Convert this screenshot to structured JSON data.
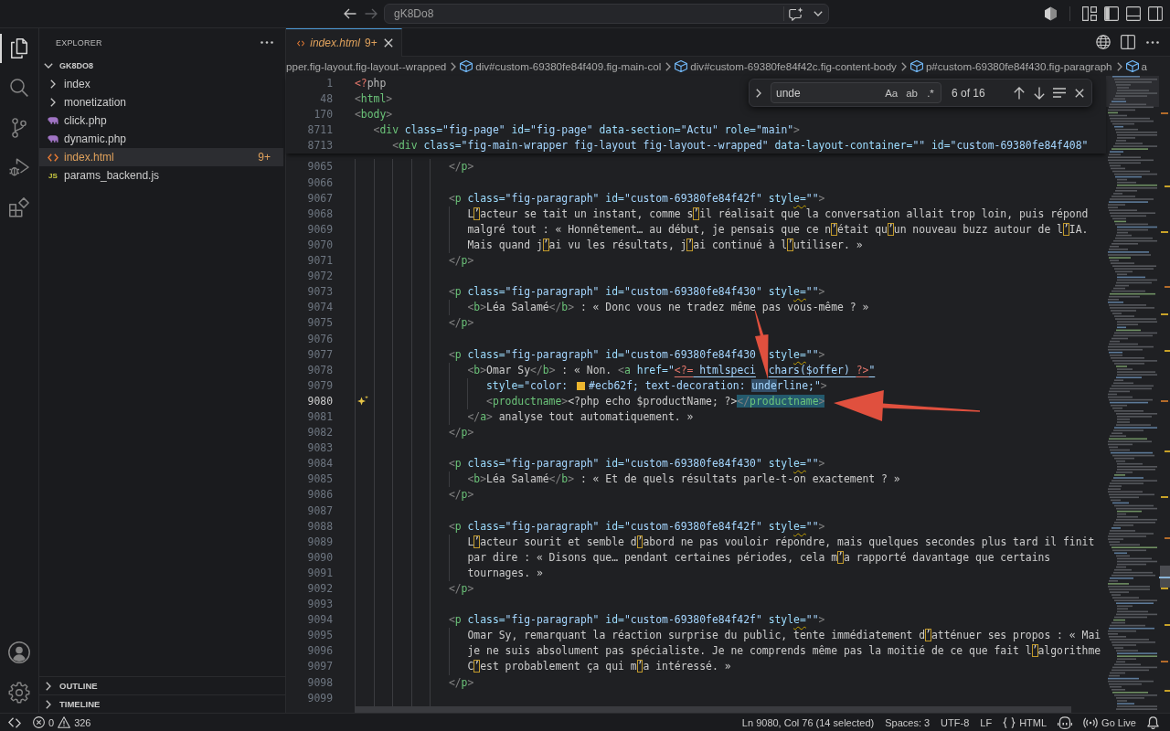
{
  "title_bar": {
    "back": {
      "disabled": false
    },
    "forward": {
      "disabled": true
    },
    "command_center": {
      "label": "gK8Do8"
    }
  },
  "activity_bar": {
    "items": [
      {
        "selected": true
      },
      {
        "selected": false
      },
      {
        "selected": false
      },
      {
        "selected": false
      },
      {
        "selected": false
      }
    ]
  },
  "sidebar": {
    "title": "EXPLORER",
    "root": {
      "name": "GK8DO8",
      "expanded": true,
      "children": [
        {
          "name": "index",
          "kind": "folder",
          "expanded": false,
          "selected": false
        },
        {
          "name": "monetization",
          "kind": "folder",
          "expanded": false,
          "selected": false
        },
        {
          "name": "click.php",
          "kind": "php",
          "selected": false
        },
        {
          "name": "dynamic.php",
          "kind": "php",
          "selected": false
        },
        {
          "name": "index.html",
          "kind": "html",
          "selected": true,
          "badge": "9+"
        },
        {
          "name": "params_backend.js",
          "kind": "js",
          "icon_label": "JS",
          "selected": false
        }
      ]
    },
    "sections": [
      {
        "title": "OUTLINE",
        "expanded": false
      },
      {
        "title": "TIMELINE",
        "expanded": false
      }
    ]
  },
  "editor": {
    "tabs": [
      {
        "label": "index.html",
        "badge": "9+",
        "preview": true,
        "selected": true
      }
    ],
    "breadcrumbs": [
      {
        "kind": "partial",
        "text": "pper.fig-layout.fig-layout--wrapped"
      },
      {
        "kind": "element",
        "text": "div#custom-69380fe84f409.fig-main-col"
      },
      {
        "kind": "element",
        "text": "div#custom-69380fe84f42c.fig-content-body"
      },
      {
        "kind": "element",
        "text": "p#custom-69380fe84f430.fig-paragraph"
      },
      {
        "kind": "element",
        "text": "a"
      }
    ],
    "find": {
      "query": "unde",
      "result": "6 of 16",
      "replace_expanded": false,
      "options": [
        {
          "label": "Aa",
          "on": false
        },
        {
          "label": "ab",
          "on": false
        },
        {
          "label": ".*",
          "on": false
        }
      ]
    },
    "sticky_lines": [
      {
        "number": "1",
        "tokens": [
          {
            "kind": "php",
            "text": "<?"
          },
          {
            "kind": "keyword",
            "text": "php"
          }
        ]
      },
      {
        "number": "48",
        "tokens": [
          {
            "kind": "punct",
            "text": "<"
          },
          {
            "kind": "tag",
            "text": "html"
          },
          {
            "kind": "punct",
            "text": ">"
          }
        ]
      },
      {
        "number": "170",
        "tokens": [
          {
            "kind": "punct",
            "text": "<"
          },
          {
            "kind": "tag",
            "text": "body"
          },
          {
            "kind": "punct",
            "text": ">"
          }
        ]
      },
      {
        "number": "8711",
        "tokens": [
          {
            "kind": "punct",
            "text": "   <"
          },
          {
            "kind": "tag",
            "text": "div"
          },
          {
            "kind": "attr",
            "text": " class="
          },
          {
            "kind": "str",
            "text": "\"fig-page\""
          },
          {
            "kind": "attr",
            "text": " id="
          },
          {
            "kind": "str",
            "text": "\"fig-page\""
          },
          {
            "kind": "attr",
            "text": " data-section="
          },
          {
            "kind": "str",
            "text": "\"Actu\""
          },
          {
            "kind": "attr",
            "text": " role="
          },
          {
            "kind": "str",
            "text": "\"main\""
          },
          {
            "kind": "punct",
            "text": ">"
          }
        ]
      },
      {
        "number": "8713",
        "tokens": [
          {
            "kind": "punct",
            "text": "      <"
          },
          {
            "kind": "tag",
            "text": "div"
          },
          {
            "kind": "attr",
            "text": " class="
          },
          {
            "kind": "str",
            "text": "\"fig-main-wrapper fig-layout fig-layout--wrapped\""
          },
          {
            "kind": "attr",
            "text": " data-layout-container="
          },
          {
            "kind": "str",
            "text": "\"\""
          },
          {
            "kind": "attr",
            "text": " id="
          },
          {
            "kind": "str",
            "text": "\"custom-69380fe84f408\""
          }
        ]
      }
    ],
    "lines": [
      {
        "number": "9065",
        "current": false,
        "tokens": [
          {
            "kind": "punct",
            "text": "               </"
          },
          {
            "kind": "tag",
            "text": "p"
          },
          {
            "kind": "punct",
            "text": ">"
          }
        ]
      },
      {
        "number": "9066",
        "current": false
      },
      {
        "number": "9067",
        "current": false,
        "tokens": [
          {
            "kind": "punct",
            "text": "               <"
          },
          {
            "kind": "tag",
            "text": "p"
          },
          {
            "kind": "attr",
            "text": " class="
          },
          {
            "kind": "str",
            "text": "\"fig-paragraph\""
          },
          {
            "kind": "attr",
            "text": " id="
          },
          {
            "kind": "str",
            "text": "\"custom-69380fe84f42f\""
          },
          {
            "kind": "attr",
            "text": " styl"
          },
          {
            "kind": "attr-warning",
            "text": "e="
          },
          {
            "kind": "str",
            "text": "\"\""
          },
          {
            "kind": "punct",
            "text": ">"
          }
        ]
      },
      {
        "number": "9068",
        "current": false,
        "tokens": [
          {
            "kind": "text",
            "text": "                  L"
          },
          {
            "kind": "ambiguous",
            "text": "’"
          },
          {
            "kind": "text",
            "text": "acteur se tait un instant, comme s"
          },
          {
            "kind": "ambiguous",
            "text": "’"
          },
          {
            "kind": "text",
            "text": "il réalisait que la conversation allait trop loin, puis répond"
          }
        ]
      },
      {
        "number": "9069",
        "current": false,
        "tokens": [
          {
            "kind": "text",
            "text": "                  malgré tout : « Honnêtement… au début, je pensais que ce n"
          },
          {
            "kind": "ambiguous",
            "text": "’"
          },
          {
            "kind": "text",
            "text": "était qu"
          },
          {
            "kind": "ambiguous",
            "text": "’"
          },
          {
            "kind": "text",
            "text": "un nouveau buzz autour de l"
          },
          {
            "kind": "ambiguous",
            "text": "’"
          },
          {
            "kind": "text",
            "text": "IA."
          }
        ]
      },
      {
        "number": "9070",
        "current": false,
        "tokens": [
          {
            "kind": "text",
            "text": "                  Mais quand j"
          },
          {
            "kind": "ambiguous",
            "text": "’"
          },
          {
            "kind": "text",
            "text": "ai vu les résultats, j"
          },
          {
            "kind": "ambiguous",
            "text": "’"
          },
          {
            "kind": "text",
            "text": "ai continué à l"
          },
          {
            "kind": "ambiguous",
            "text": "’"
          },
          {
            "kind": "text",
            "text": "utiliser. »"
          }
        ]
      },
      {
        "number": "9071",
        "current": false,
        "tokens": [
          {
            "kind": "punct",
            "text": "               </"
          },
          {
            "kind": "tag",
            "text": "p"
          },
          {
            "kind": "punct",
            "text": ">"
          }
        ]
      },
      {
        "number": "9072",
        "current": false
      },
      {
        "number": "9073",
        "current": false,
        "tokens": [
          {
            "kind": "punct",
            "text": "               <"
          },
          {
            "kind": "tag",
            "text": "p"
          },
          {
            "kind": "attr",
            "text": " class="
          },
          {
            "kind": "str",
            "text": "\"fig-paragraph\""
          },
          {
            "kind": "attr",
            "text": " id="
          },
          {
            "kind": "str",
            "text": "\"custom-69380fe84f430\""
          },
          {
            "kind": "attr",
            "text": " styl"
          },
          {
            "kind": "attr-warning",
            "text": "e="
          },
          {
            "kind": "str",
            "text": "\"\""
          },
          {
            "kind": "punct",
            "text": ">"
          }
        ]
      },
      {
        "number": "9074",
        "current": false,
        "tokens": [
          {
            "kind": "punct",
            "text": "                  <"
          },
          {
            "kind": "tag",
            "text": "b"
          },
          {
            "kind": "punct",
            "text": ">"
          },
          {
            "kind": "text",
            "text": "Léa Salamé"
          },
          {
            "kind": "punct",
            "text": "</"
          },
          {
            "kind": "tag",
            "text": "b"
          },
          {
            "kind": "punct",
            "text": ">"
          },
          {
            "kind": "text",
            "text": " : « Donc vous ne tradez même pas vous-même ? »"
          }
        ]
      },
      {
        "number": "9075",
        "current": false,
        "tokens": [
          {
            "kind": "punct",
            "text": "               </"
          },
          {
            "kind": "tag",
            "text": "p"
          },
          {
            "kind": "punct",
            "text": ">"
          }
        ]
      },
      {
        "number": "9076",
        "current": false
      },
      {
        "number": "9077",
        "current": false,
        "tokens": [
          {
            "kind": "punct",
            "text": "               <"
          },
          {
            "kind": "tag",
            "text": "p"
          },
          {
            "kind": "attr",
            "text": " class="
          },
          {
            "kind": "str",
            "text": "\"fig-paragraph\""
          },
          {
            "kind": "attr",
            "text": " id="
          },
          {
            "kind": "str",
            "text": "\"custom-69380fe84f430"
          },
          {
            "kind": "covered"
          },
          {
            "kind": "attr",
            "text": "styl"
          },
          {
            "kind": "attr-warning",
            "text": "e="
          },
          {
            "kind": "str",
            "text": "\"\""
          },
          {
            "kind": "punct",
            "text": ">"
          }
        ]
      },
      {
        "number": "9078",
        "current": false,
        "tokens": [
          {
            "kind": "punct",
            "text": "                  <"
          },
          {
            "kind": "tag",
            "text": "b"
          },
          {
            "kind": "punct",
            "text": ">"
          },
          {
            "kind": "text",
            "text": "Omar Sy"
          },
          {
            "kind": "punct",
            "text": "</"
          },
          {
            "kind": "tag",
            "text": "b"
          },
          {
            "kind": "punct",
            "text": ">"
          },
          {
            "kind": "text",
            "text": " : « Non. "
          },
          {
            "kind": "punct",
            "text": "<"
          },
          {
            "kind": "tag",
            "text": "a"
          },
          {
            "kind": "attr",
            "text": " href="
          },
          {
            "kind": "str",
            "text": "\""
          },
          {
            "kind": "php-link",
            "text": "<?="
          },
          {
            "kind": "str-link",
            "text": " htmlspeci"
          },
          {
            "kind": "covered"
          },
          {
            "kind": "str-link",
            "text": "chars($offer) "
          },
          {
            "kind": "php-link",
            "text": "?>"
          },
          {
            "kind": "str-link",
            "text": "\""
          }
        ]
      },
      {
        "number": "9079",
        "current": false,
        "tokens": [
          {
            "kind": "attr",
            "text": "                     style="
          },
          {
            "kind": "str",
            "text": "\"color: "
          },
          {
            "kind": "swatch",
            "color": "#ecb62f"
          },
          {
            "kind": "str",
            "text": "#ecb62f; text-decoration: "
          },
          {
            "kind": "str-match",
            "text": "unde"
          },
          {
            "kind": "str",
            "text": "rline;\""
          },
          {
            "kind": "punct",
            "text": ">"
          }
        ]
      },
      {
        "number": "9080",
        "current": true,
        "tokens": [
          {
            "kind": "punct",
            "text": "                     <"
          },
          {
            "kind": "tag",
            "text": "productname"
          },
          {
            "kind": "punct",
            "text": ">"
          },
          {
            "kind": "text",
            "text": "<?php echo $productName; ?>"
          },
          {
            "kind": "punct-selected",
            "text": "</"
          },
          {
            "kind": "tag-selected",
            "text": "productname"
          },
          {
            "kind": "punct-selected",
            "text": ">"
          }
        ]
      },
      {
        "number": "9081",
        "current": false,
        "tokens": [
          {
            "kind": "punct",
            "text": "                  </"
          },
          {
            "kind": "tag",
            "text": "a"
          },
          {
            "kind": "punct",
            "text": ">"
          },
          {
            "kind": "text",
            "text": " analyse tout automatiquement. »"
          }
        ]
      },
      {
        "number": "9082",
        "current": false,
        "tokens": [
          {
            "kind": "punct",
            "text": "               </"
          },
          {
            "kind": "tag",
            "text": "p"
          },
          {
            "kind": "punct",
            "text": ">"
          }
        ]
      },
      {
        "number": "9083",
        "current": false
      },
      {
        "number": "9084",
        "current": false,
        "tokens": [
          {
            "kind": "punct",
            "text": "               <"
          },
          {
            "kind": "tag",
            "text": "p"
          },
          {
            "kind": "attr",
            "text": " class="
          },
          {
            "kind": "str",
            "text": "\"fig-paragraph\""
          },
          {
            "kind": "attr",
            "text": " id="
          },
          {
            "kind": "str",
            "text": "\"custom-69380fe84f430\""
          },
          {
            "kind": "attr",
            "text": " styl"
          },
          {
            "kind": "attr-warning",
            "text": "e="
          },
          {
            "kind": "str",
            "text": "\"\""
          },
          {
            "kind": "punct",
            "text": ">"
          }
        ]
      },
      {
        "number": "9085",
        "current": false,
        "tokens": [
          {
            "kind": "punct",
            "text": "                  <"
          },
          {
            "kind": "tag",
            "text": "b"
          },
          {
            "kind": "punct",
            "text": ">"
          },
          {
            "kind": "text",
            "text": "Léa Salamé"
          },
          {
            "kind": "punct",
            "text": "</"
          },
          {
            "kind": "tag",
            "text": "b"
          },
          {
            "kind": "punct",
            "text": ">"
          },
          {
            "kind": "text",
            "text": " : « Et de quels résultats parle-t-on exactement ? »"
          }
        ]
      },
      {
        "number": "9086",
        "current": false,
        "tokens": [
          {
            "kind": "punct",
            "text": "               </"
          },
          {
            "kind": "tag",
            "text": "p"
          },
          {
            "kind": "punct",
            "text": ">"
          }
        ]
      },
      {
        "number": "9087",
        "current": false
      },
      {
        "number": "9088",
        "current": false,
        "tokens": [
          {
            "kind": "punct",
            "text": "               <"
          },
          {
            "kind": "tag",
            "text": "p"
          },
          {
            "kind": "attr",
            "text": " class="
          },
          {
            "kind": "str",
            "text": "\"fig-paragraph\""
          },
          {
            "kind": "attr",
            "text": " id="
          },
          {
            "kind": "str",
            "text": "\"custom-69380fe84f42f\""
          },
          {
            "kind": "attr",
            "text": " styl"
          },
          {
            "kind": "attr-warning",
            "text": "e="
          },
          {
            "kind": "str",
            "text": "\"\""
          },
          {
            "kind": "punct",
            "text": ">"
          }
        ]
      },
      {
        "number": "9089",
        "current": false,
        "tokens": [
          {
            "kind": "text",
            "text": "                  L"
          },
          {
            "kind": "ambiguous",
            "text": "’"
          },
          {
            "kind": "text",
            "text": "acteur sourit et semble d"
          },
          {
            "kind": "ambiguous",
            "text": "’"
          },
          {
            "kind": "text",
            "text": "abord ne pas vouloir répondre, mais quelques secondes plus tard il finit"
          }
        ]
      },
      {
        "number": "9090",
        "current": false,
        "tokens": [
          {
            "kind": "text",
            "text": "                  par dire : « Disons que… pendant certaines périodes, cela m"
          },
          {
            "kind": "ambiguous",
            "text": "’"
          },
          {
            "kind": "text",
            "text": "a rapporté davantage que certains"
          }
        ]
      },
      {
        "number": "9091",
        "current": false,
        "tokens": [
          {
            "kind": "text",
            "text": "                  tournages. »"
          }
        ]
      },
      {
        "number": "9092",
        "current": false,
        "tokens": [
          {
            "kind": "punct",
            "text": "               </"
          },
          {
            "kind": "tag",
            "text": "p"
          },
          {
            "kind": "punct",
            "text": ">"
          }
        ]
      },
      {
        "number": "9093",
        "current": false
      },
      {
        "number": "9094",
        "current": false,
        "tokens": [
          {
            "kind": "punct",
            "text": "               <"
          },
          {
            "kind": "tag",
            "text": "p"
          },
          {
            "kind": "attr",
            "text": " class="
          },
          {
            "kind": "str",
            "text": "\"fig-paragraph\""
          },
          {
            "kind": "attr",
            "text": " id="
          },
          {
            "kind": "str",
            "text": "\"custom-69380fe84f42f\""
          },
          {
            "kind": "attr",
            "text": " styl"
          },
          {
            "kind": "attr-warning",
            "text": "e="
          },
          {
            "kind": "str",
            "text": "\"\""
          },
          {
            "kind": "punct",
            "text": ">"
          }
        ]
      },
      {
        "number": "9095",
        "current": false,
        "tokens": [
          {
            "kind": "text",
            "text": "                  Omar Sy, remarquant la réaction surprise du public, tente immédiatement d"
          },
          {
            "kind": "ambiguous",
            "text": "’"
          },
          {
            "kind": "text",
            "text": "atténuer ses propos : « Mai"
          }
        ]
      },
      {
        "number": "9096",
        "current": false,
        "tokens": [
          {
            "kind": "text",
            "text": "                  je ne suis absolument pas spécialiste. Je ne comprends même pas la moitié de ce que fait l"
          },
          {
            "kind": "ambiguous",
            "text": "’"
          },
          {
            "kind": "text",
            "text": "algorithme"
          }
        ]
      },
      {
        "number": "9097",
        "current": false,
        "tokens": [
          {
            "kind": "text",
            "text": "                  C"
          },
          {
            "kind": "ambiguous",
            "text": "’"
          },
          {
            "kind": "text",
            "text": "est probablement ça qui m"
          },
          {
            "kind": "ambiguous",
            "text": "’"
          },
          {
            "kind": "text",
            "text": "a intéressé. »"
          }
        ]
      },
      {
        "number": "9098",
        "current": false,
        "tokens": [
          {
            "kind": "punct",
            "text": "               </"
          },
          {
            "kind": "tag",
            "text": "p"
          },
          {
            "kind": "punct",
            "text": ">"
          }
        ]
      },
      {
        "number": "9099",
        "current": false
      }
    ]
  },
  "status_bar": {
    "errors": "0",
    "warnings": "326",
    "cursor": "Ln 9080, Col 76 (14 selected)",
    "indentation": "Spaces: 3",
    "encoding": "UTF-8",
    "eol": "LF",
    "language": "HTML",
    "live_server": "Go Live"
  }
}
